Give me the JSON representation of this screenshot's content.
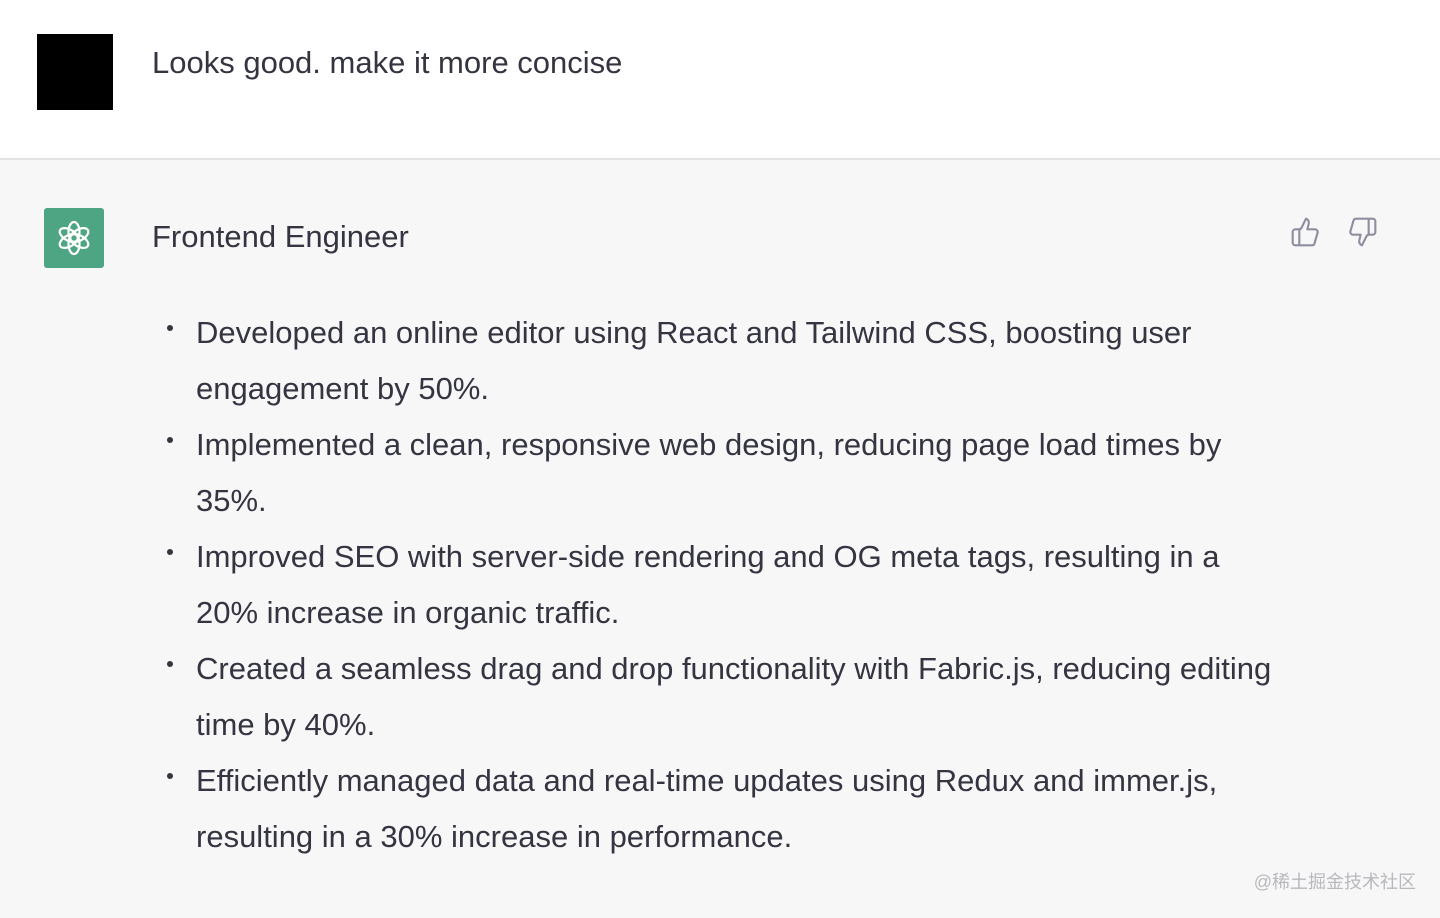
{
  "user_message": {
    "text": "Looks good. make it more concise"
  },
  "assistant_message": {
    "title": "Frontend Engineer",
    "bullets": [
      "Developed an online editor using React and Tailwind CSS, boosting user engagement by 50%.",
      "Implemented a clean, responsive web design, reducing page load times by 35%.",
      "Improved SEO with server-side rendering and OG meta tags, resulting in a 20% increase in organic traffic.",
      "Created a seamless drag and drop functionality with Fabric.js, reducing editing time by 40%.",
      "Efficiently managed data and real-time updates using Redux and immer.js, resulting in a 30% increase in performance."
    ],
    "feedback_icons": [
      "thumbs-up-icon",
      "thumbs-down-icon"
    ]
  },
  "watermark": "@稀土掘金技术社区",
  "colors": {
    "bot_avatar": "#4ea584",
    "assistant_bg": "#f7f7f8",
    "text": "#343541"
  }
}
